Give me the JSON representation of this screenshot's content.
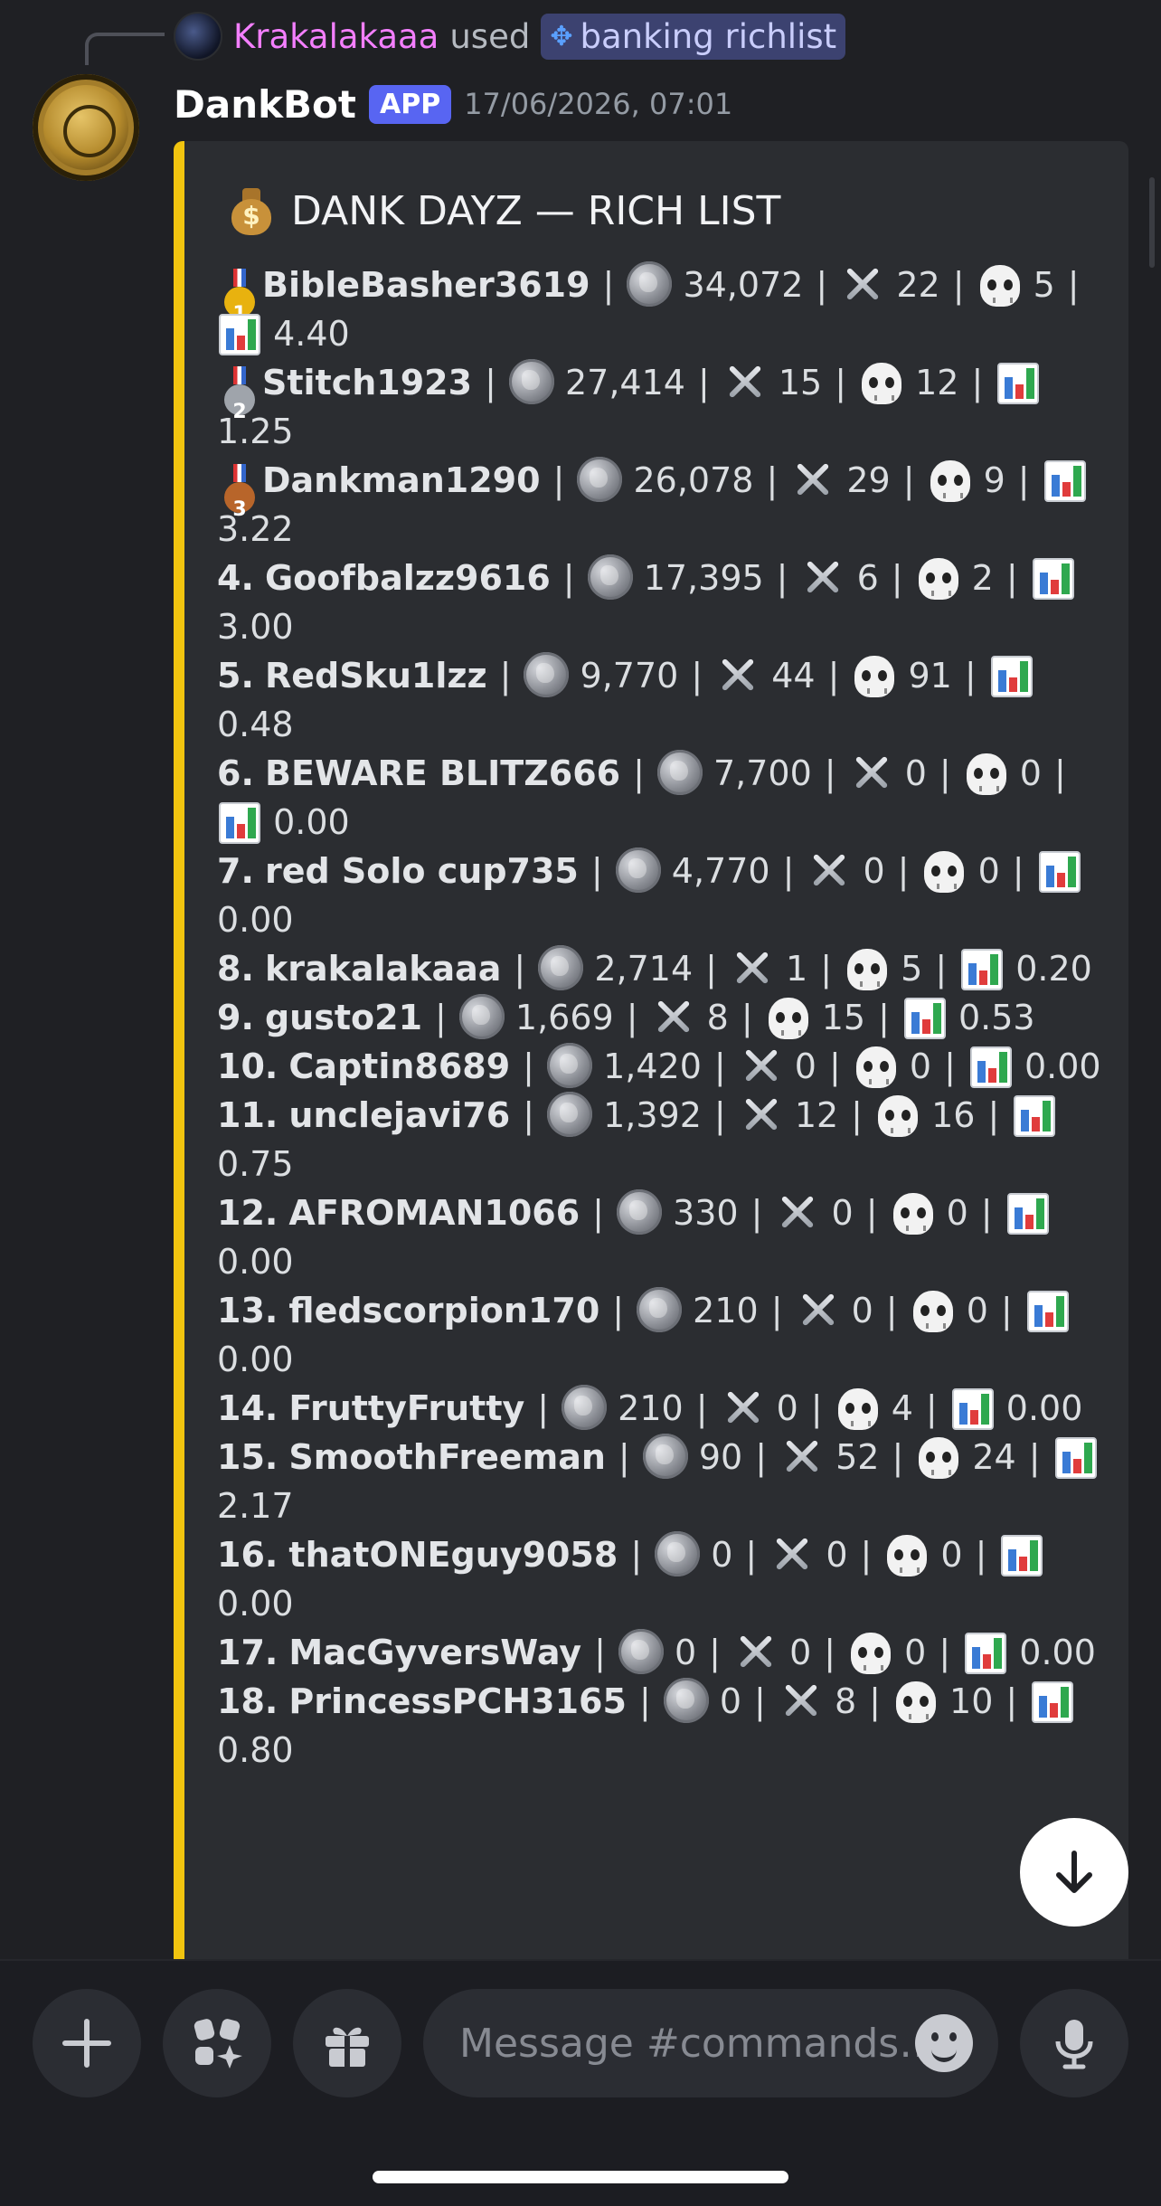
{
  "reply": {
    "user": "Krakalakaaa",
    "used_text": "used",
    "command": "banking richlist"
  },
  "message": {
    "bot_name": "DankBot",
    "badge": "APP",
    "timestamp": "17/06/2026, 07:01"
  },
  "embed": {
    "accent_color": "#f1c40f",
    "title": "DANK DAYZ — RICH LIST",
    "title_icon": "money-bag-icon",
    "column_icons": [
      "coin-icon",
      "crossed-swords-icon",
      "skull-icon",
      "bar-chart-icon"
    ],
    "rows": [
      {
        "rank": "1",
        "medal": "gold",
        "name": "BibleBasher3619",
        "coins": "34,072",
        "kills": "22",
        "deaths": "5",
        "kd": "4.40"
      },
      {
        "rank": "2",
        "medal": "silver",
        "name": "Stitch1923",
        "coins": "27,414",
        "kills": "15",
        "deaths": "12",
        "kd": "1.25"
      },
      {
        "rank": "3",
        "medal": "bronze",
        "name": "Dankman1290",
        "coins": "26,078",
        "kills": "29",
        "deaths": "9",
        "kd": "3.22"
      },
      {
        "rank": "4.",
        "name": "Goofbalzz9616",
        "coins": "17,395",
        "kills": "6",
        "deaths": "2",
        "kd": "3.00"
      },
      {
        "rank": "5.",
        "name": "RedSku1lzz",
        "coins": "9,770",
        "kills": "44",
        "deaths": "91",
        "kd": "0.48"
      },
      {
        "rank": "6.",
        "name": "BEWARE BLITZ666",
        "coins": "7,700",
        "kills": "0",
        "deaths": "0",
        "kd": "0.00"
      },
      {
        "rank": "7.",
        "name": "red Solo cup735",
        "coins": "4,770",
        "kills": "0",
        "deaths": "0",
        "kd": "0.00"
      },
      {
        "rank": "8.",
        "name": "krakalakaaa",
        "coins": "2,714",
        "kills": "1",
        "deaths": "5",
        "kd": "0.20"
      },
      {
        "rank": "9.",
        "name": "gusto21",
        "coins": "1,669",
        "kills": "8",
        "deaths": "15",
        "kd": "0.53"
      },
      {
        "rank": "10.",
        "name": "Captin8689",
        "coins": "1,420",
        "kills": "0",
        "deaths": "0",
        "kd": "0.00"
      },
      {
        "rank": "11.",
        "name": "unclejavi76",
        "coins": "1,392",
        "kills": "12",
        "deaths": "16",
        "kd": "0.75"
      },
      {
        "rank": "12.",
        "name": "AFROMAN1066",
        "coins": "330",
        "kills": "0",
        "deaths": "0",
        "kd": "0.00"
      },
      {
        "rank": "13.",
        "name": "fledscorpion170",
        "coins": "210",
        "kills": "0",
        "deaths": "0",
        "kd": "0.00"
      },
      {
        "rank": "14.",
        "name": "FruttyFrutty",
        "coins": "210",
        "kills": "0",
        "deaths": "4",
        "kd": "0.00"
      },
      {
        "rank": "15.",
        "name": "SmoothFreeman",
        "coins": "90",
        "kills": "52",
        "deaths": "24",
        "kd": "2.17"
      },
      {
        "rank": "16.",
        "name": "thatONEguy9058",
        "coins": "0",
        "kills": "0",
        "deaths": "0",
        "kd": "0.00"
      },
      {
        "rank": "17.",
        "name": "MacGyversWay",
        "coins": "0",
        "kills": "0",
        "deaths": "0",
        "kd": "0.00"
      },
      {
        "rank": "18.",
        "name": "PrincessPCH3165",
        "coins": "0",
        "kills": "8",
        "deaths": "10",
        "kd": "0.80"
      }
    ]
  },
  "composer": {
    "placeholder": "Message #commands…",
    "buttons": [
      "plus-icon",
      "apps-icon",
      "gift-icon",
      "emoji-icon",
      "microphone-icon"
    ]
  },
  "scroll_button": "arrow-down-icon"
}
